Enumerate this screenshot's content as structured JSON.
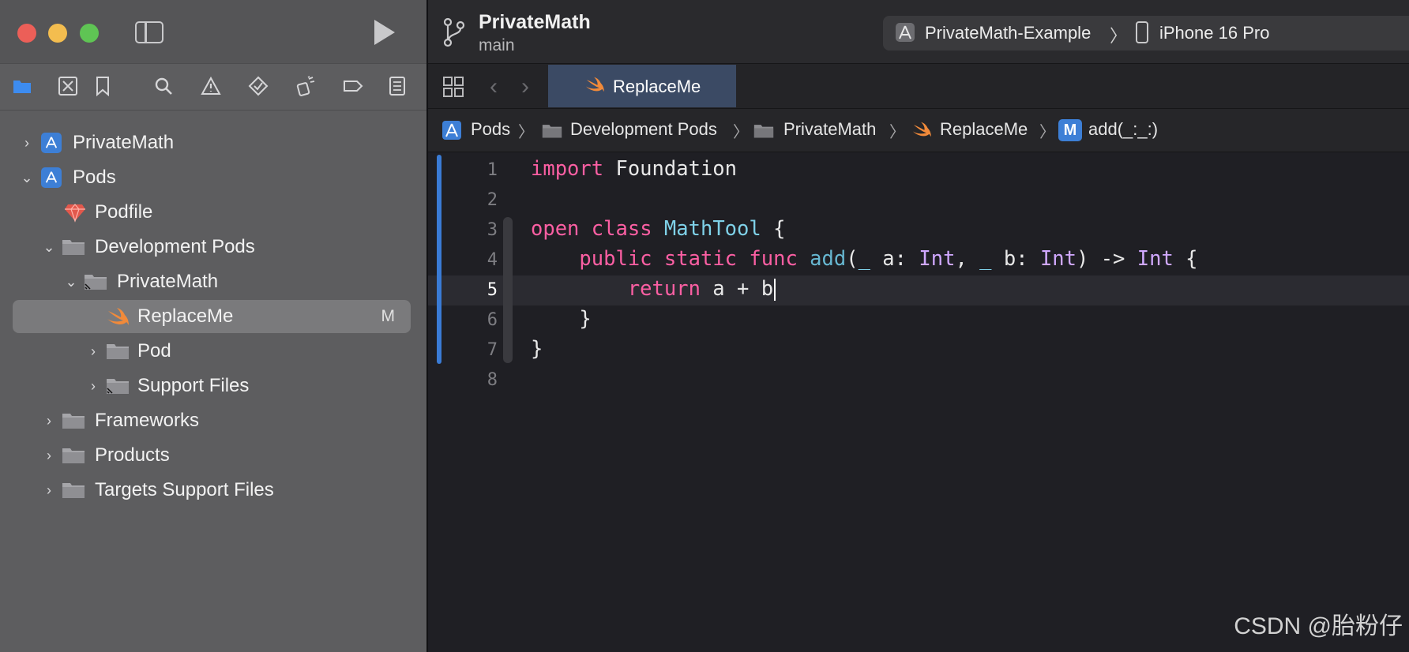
{
  "window": {
    "project_title": "PrivateMath",
    "branch": "main",
    "scheme": "PrivateMath-Example",
    "scheme_separator": "〉",
    "device": "iPhone 16 Pro"
  },
  "navigator_tabs": [
    "project-navigator",
    "source-control-navigator",
    "bookmark-navigator",
    "find-navigator",
    "issue-navigator",
    "test-navigator",
    "debug-navigator",
    "breakpoint-navigator",
    "report-navigator"
  ],
  "tree": [
    {
      "label": "PrivateMath",
      "icon": "app-icon",
      "disclosure": "collapsed"
    },
    {
      "label": "Pods",
      "icon": "app-icon",
      "disclosure": "expanded"
    },
    {
      "label": "Podfile",
      "icon": "ruby-gem-icon",
      "disclosure": "none"
    },
    {
      "label": "Development Pods",
      "icon": "folder-icon",
      "disclosure": "expanded"
    },
    {
      "label": "PrivateMath",
      "icon": "folder-icon",
      "disclosure": "expanded"
    },
    {
      "label": "ReplaceMe",
      "icon": "swift-icon",
      "disclosure": "none",
      "badge": "M",
      "selected": true
    },
    {
      "label": "Pod",
      "icon": "folder-icon",
      "disclosure": "collapsed"
    },
    {
      "label": "Support Files",
      "icon": "folder-icon",
      "disclosure": "collapsed"
    },
    {
      "label": "Frameworks",
      "icon": "folder-icon",
      "disclosure": "collapsed"
    },
    {
      "label": "Products",
      "icon": "folder-icon",
      "disclosure": "collapsed"
    },
    {
      "label": "Targets Support Files",
      "icon": "folder-icon",
      "disclosure": "collapsed"
    }
  ],
  "editor": {
    "tab_title": "ReplaceMe",
    "jumpbar": {
      "items": [
        "Pods",
        "Development Pods",
        "PrivateMath",
        "ReplaceMe",
        "add(_:_:)"
      ],
      "method_badge": "M",
      "separator": "〉"
    },
    "current_line": 5,
    "lines": [
      {
        "n": "1",
        "text": "import Foundation"
      },
      {
        "n": "2",
        "text": ""
      },
      {
        "n": "3",
        "text": "open class MathTool {"
      },
      {
        "n": "4",
        "text": "    public static func add(_ a: Int, _ b: Int) -> Int {"
      },
      {
        "n": "5",
        "text": "        return a + b"
      },
      {
        "n": "6",
        "text": "    }"
      },
      {
        "n": "7",
        "text": "}"
      },
      {
        "n": "8",
        "text": ""
      }
    ]
  },
  "watermark": "CSDN @胎粉仔",
  "colors": {
    "keyword": "#fc5fa3",
    "type": "#7fd1e8",
    "std_type": "#d0a8ff",
    "function": "#67b7d1",
    "accent": "#3a7bd5"
  }
}
